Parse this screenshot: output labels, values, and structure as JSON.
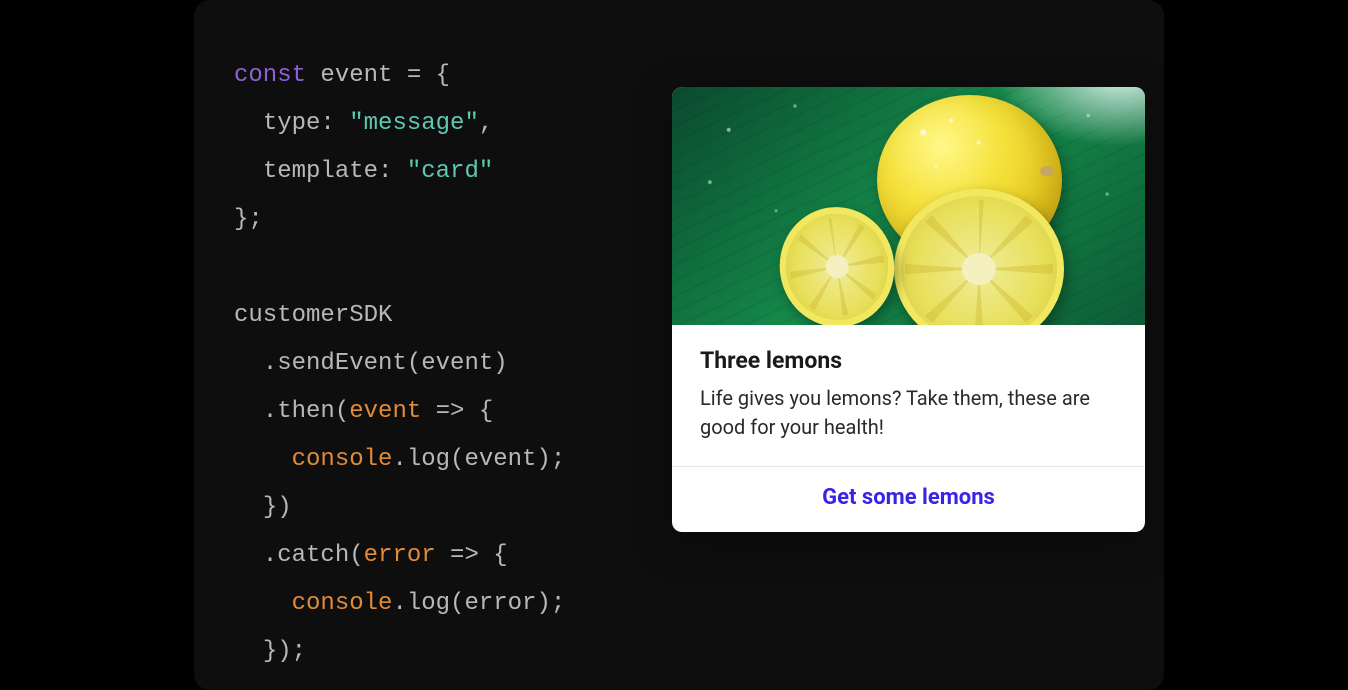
{
  "code": {
    "line1_keyword": "const",
    "line1_var": " event ",
    "line1_punct": "= {",
    "line2_indent": "  ",
    "line2_prop": "type: ",
    "line2_string": "\"message\"",
    "line2_punct": ",",
    "line3_indent": "  ",
    "line3_prop": "template: ",
    "line3_string": "\"card\"",
    "line4": "};",
    "line5": "",
    "line6": "customerSDK",
    "line7_indent": "  ",
    "line7_call": ".sendEvent(event)",
    "line8_indent": "  ",
    "line8_a": ".then(",
    "line8_param": "event",
    "line8_b": " => {",
    "line9_indent": "    ",
    "line9_obj": "console",
    "line9_b": ".log(event);",
    "line10_indent": "  ",
    "line10": "})",
    "line11_indent": "  ",
    "line11_a": ".catch(",
    "line11_param": "error",
    "line11_b": " => {",
    "line12_indent": "    ",
    "line12_obj": "console",
    "line12_b": ".log(error);",
    "line13_indent": "  ",
    "line13": "});"
  },
  "card": {
    "image_alt": "lemons-on-leaf",
    "title": "Three lemons",
    "description": "Life gives you lemons? Take them, these are good for your health!",
    "cta": "Get some lemons"
  }
}
